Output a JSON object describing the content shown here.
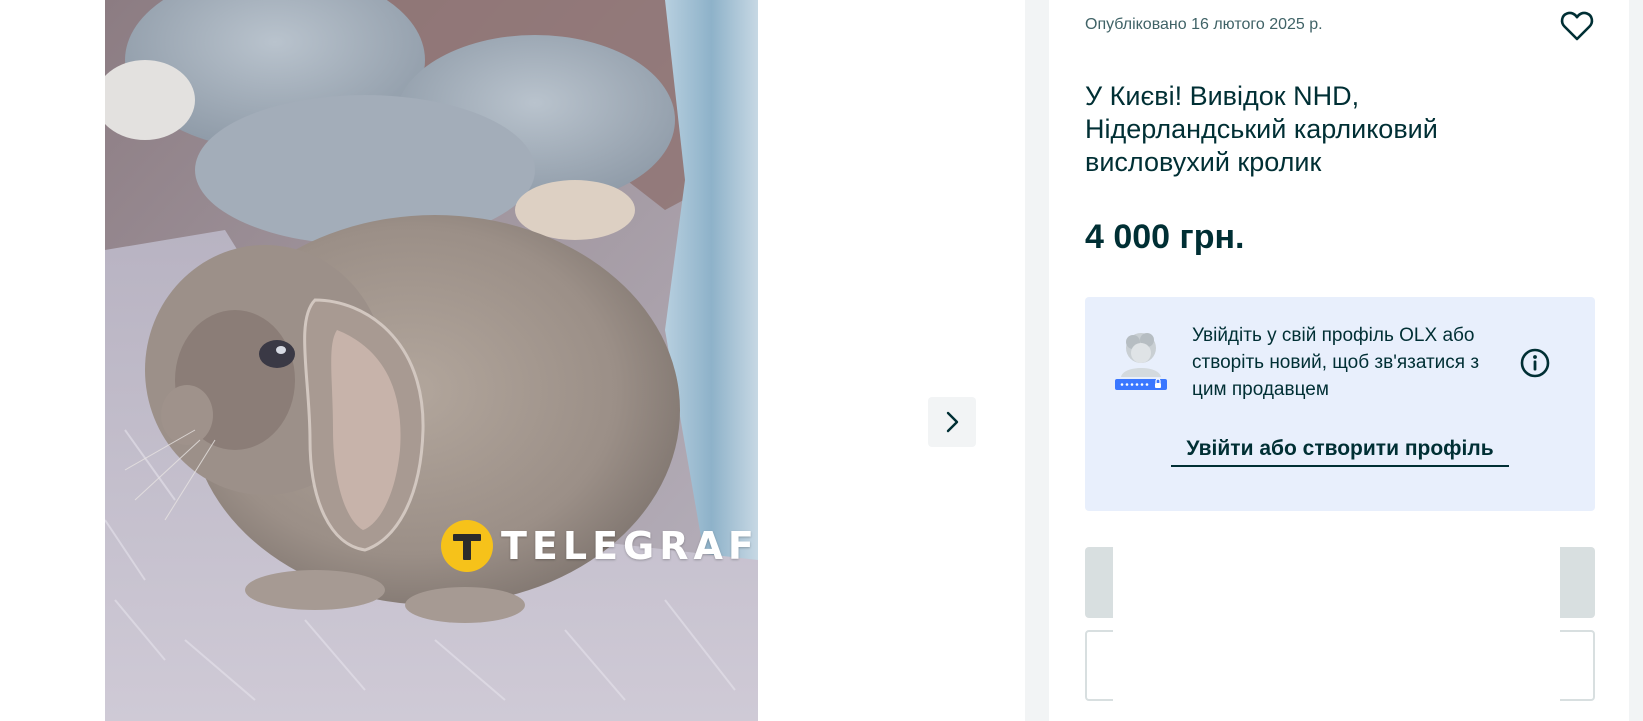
{
  "gallery": {
    "watermark_text": "TELEGRAF",
    "next_icon": "chevron-right-icon"
  },
  "listing": {
    "posted": "Опубліковано 16 лютого 2025 р.",
    "favorite_icon": "heart-icon",
    "title": "У Києві! Вивідок NHD, Нідерландський карликовий висловухий кролик",
    "price": "4 000 грн."
  },
  "login": {
    "text": "Увійдіть у свій профіль OLX або створіть новий, щоб зв'язатися з цим продавцем",
    "link": "Увійти або створити профіль",
    "avatar_icon": "avatar-placeholder-icon",
    "info_icon": "info-icon"
  },
  "colors": {
    "text_primary": "#002f34",
    "text_secondary": "#406367",
    "login_box_bg": "#e8effc",
    "page_side_bg": "#f2f4f5",
    "watermark_logo": "#f6c21a"
  }
}
